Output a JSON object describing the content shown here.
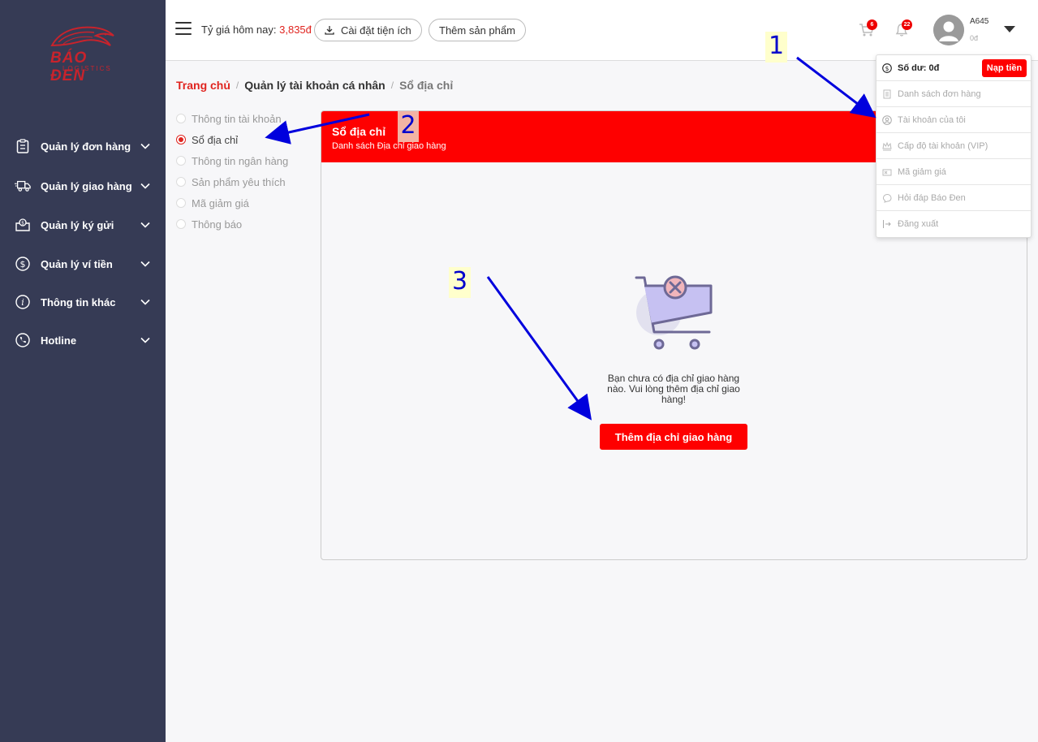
{
  "brand": {
    "name": "BÁO ĐEN",
    "tagline": "LOGISTICS",
    "color": "#c8232c"
  },
  "sidebar": {
    "bg": "#363b55",
    "items": [
      {
        "label": "Quản lý đơn hàng",
        "icon": "clipboard-icon"
      },
      {
        "label": "Quản lý giao hàng",
        "icon": "truck-icon"
      },
      {
        "label": "Quản lý ký gửi",
        "icon": "money-box-icon"
      },
      {
        "label": "Quản lý ví tiền",
        "icon": "dollar-circle-icon"
      },
      {
        "label": "Thông tin khác",
        "icon": "info-icon"
      },
      {
        "label": "Hotline",
        "icon": "phone-icon"
      }
    ]
  },
  "topbar": {
    "rate_label": "Tỷ giá hôm nay:",
    "rate_value": "3,835đ",
    "install_label": "Cài đặt tiện ích",
    "add_product_label": "Thêm sản phẩm",
    "cart_count": "6",
    "notif_count": "22",
    "username": "A645",
    "balance": "0đ"
  },
  "breadcrumb": {
    "home": "Trang chủ",
    "section": "Quản lý tài khoản cá nhân",
    "current": "Sổ địa chỉ"
  },
  "account_menu": {
    "items": [
      {
        "label": "Thông tin tài khoản",
        "selected": false
      },
      {
        "label": "Sổ địa chỉ",
        "selected": true
      },
      {
        "label": "Thông tin ngân hàng",
        "selected": false
      },
      {
        "label": "Sản phẩm yêu thích",
        "selected": false
      },
      {
        "label": "Mã giảm giá",
        "selected": false
      },
      {
        "label": "Thông báo",
        "selected": false
      }
    ]
  },
  "card": {
    "title": "Sổ địa chỉ",
    "subtitle": "Danh sách Địa chỉ giao hàng",
    "empty_message": "Bạn chưa có địa chỉ giao hàng nào. Vui lòng thêm địa chỉ giao hàng!",
    "add_button": "Thêm địa chỉ giao hàng",
    "accent": "#fe0000"
  },
  "user_dropdown": {
    "balance_label": "Số dư: 0đ",
    "topup_label": "Nạp tiền",
    "items": [
      {
        "label": "Danh sách đơn hàng",
        "icon": "document-icon"
      },
      {
        "label": "Tài khoản của tôi",
        "icon": "user-circle-icon"
      },
      {
        "label": "Cấp độ tài khoản (VIP)",
        "icon": "crown-icon"
      },
      {
        "label": "Mã giảm giá",
        "icon": "coupon-icon"
      },
      {
        "label": "Hỏi đáp Báo Đen",
        "icon": "chat-icon"
      },
      {
        "label": "Đăng xuất",
        "icon": "logout-icon"
      }
    ]
  },
  "annotations": {
    "step1": "1",
    "step2": "2",
    "step3": "3",
    "arrow_color": "#0000dd"
  }
}
